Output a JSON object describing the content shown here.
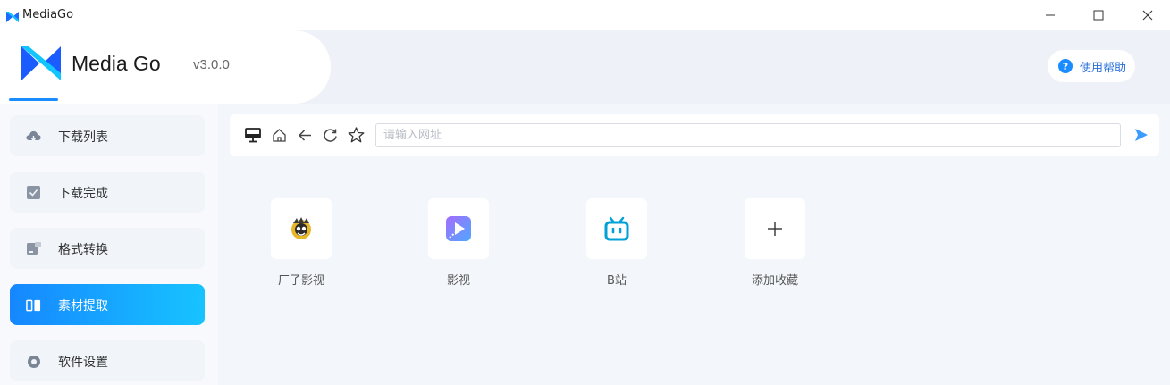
{
  "window": {
    "title": "MediaGo",
    "controls": [
      "minimize",
      "maximize",
      "close"
    ]
  },
  "header": {
    "brand_name": "Media Go",
    "version": "v3.0.0",
    "help_label": "使用帮助"
  },
  "sidebar": {
    "items": [
      {
        "label": "下载列表",
        "icon": "cloud-download-icon",
        "active": false
      },
      {
        "label": "下载完成",
        "icon": "check-box-icon",
        "active": false
      },
      {
        "label": "格式转换",
        "icon": "convert-icon",
        "active": false
      },
      {
        "label": "素材提取",
        "icon": "extract-icon",
        "active": true
      },
      {
        "label": "软件设置",
        "icon": "settings-icon",
        "active": false
      }
    ]
  },
  "browser": {
    "url_value": "",
    "url_placeholder": "请输入网址",
    "toolbar_icons": [
      "monitor-icon",
      "home-icon",
      "back-arrow-icon",
      "refresh-icon",
      "star-icon"
    ]
  },
  "bookmarks": [
    {
      "label": "厂子影视",
      "icon": "character-logo-icon"
    },
    {
      "label": "影视",
      "icon": "video-play-icon"
    },
    {
      "label": "B站",
      "icon": "bilibili-tv-icon"
    },
    {
      "label": "添加收藏",
      "icon": "plus-icon"
    }
  ],
  "colors": {
    "accent": "#1a8cff",
    "accent_gradient_end": "#17c3ff",
    "background": "#f3f6fa",
    "bilibili": "#00a1d6"
  }
}
